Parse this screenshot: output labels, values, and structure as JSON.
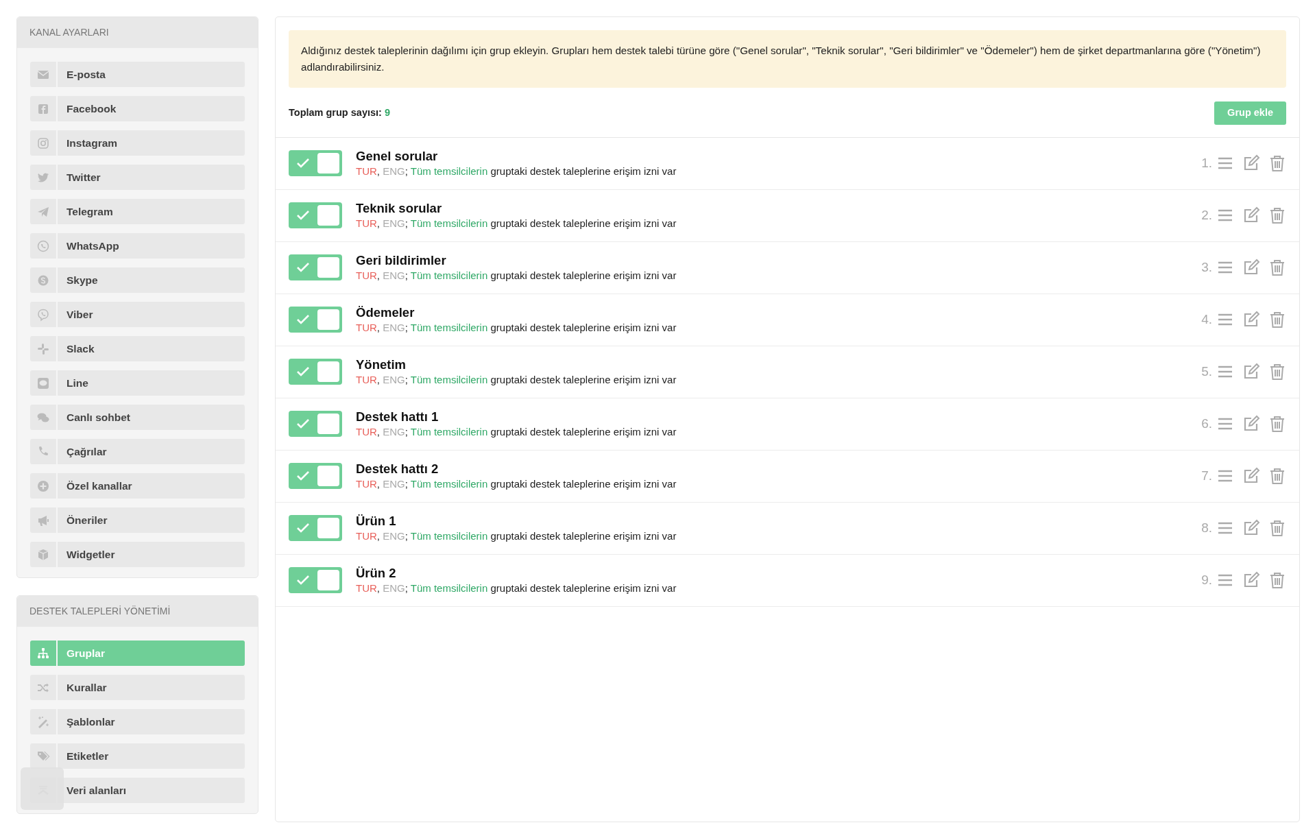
{
  "sidebar": [
    {
      "title": "KANAL AYARLARI",
      "items": [
        {
          "label": "E-posta",
          "selected": false
        },
        {
          "label": "Facebook",
          "selected": false
        },
        {
          "label": "Instagram",
          "selected": false
        },
        {
          "label": "Twitter",
          "selected": false
        },
        {
          "label": "Telegram",
          "selected": false
        },
        {
          "label": "WhatsApp",
          "selected": false
        },
        {
          "label": "Skype",
          "selected": false
        },
        {
          "label": "Viber",
          "selected": false
        },
        {
          "label": "Slack",
          "selected": false
        },
        {
          "label": "Line",
          "selected": false
        },
        {
          "label": "Canlı sohbet",
          "selected": false
        },
        {
          "label": "Çağrılar",
          "selected": false
        },
        {
          "label": "Özel kanallar",
          "selected": false
        },
        {
          "label": "Öneriler",
          "selected": false
        },
        {
          "label": "Widgetler",
          "selected": false
        }
      ]
    },
    {
      "title": "DESTEK TALEPLERİ YÖNETİMİ",
      "items": [
        {
          "label": "Gruplar",
          "selected": true
        },
        {
          "label": "Kurallar",
          "selected": false
        },
        {
          "label": "Şablonlar",
          "selected": false
        },
        {
          "label": "Etiketler",
          "selected": false
        },
        {
          "label": "Veri alanları",
          "selected": false
        }
      ]
    }
  ],
  "info": "Aldığınız destek taleplerinin dağılımı için grup ekleyin. Grupları hem destek talebi türüne göre (\"Genel sorular\", \"Teknik sorular\", \"Geri bildirimler\" ve \"Ödemeler\") hem de şirket departmanlarına göre (\"Yönetim\") adlandırabilirsiniz.",
  "total": {
    "label": "Toplam grup sayısı:",
    "value": "9"
  },
  "add_button": "Grup ekle",
  "groups": [
    {
      "number": "1.",
      "name": "Genel sorular",
      "on": true,
      "description": [
        {
          "text": "TUR",
          "color": "#e8605a"
        },
        {
          "text": ", "
        },
        {
          "text": "ENG",
          "color": "#aaaaaa"
        },
        {
          "text": "; "
        },
        {
          "text": "Tüm temsilcilerin",
          "color": "#2fa866"
        },
        {
          "text": " gruptaki destek taleplerine erişim izni var"
        }
      ]
    },
    {
      "number": "2.",
      "name": "Teknik sorular",
      "on": true,
      "description": [
        {
          "text": "TUR",
          "color": "#e8605a"
        },
        {
          "text": ", "
        },
        {
          "text": "ENG",
          "color": "#aaaaaa"
        },
        {
          "text": "; "
        },
        {
          "text": "Tüm temsilcilerin",
          "color": "#2fa866"
        },
        {
          "text": " gruptaki destek taleplerine erişim izni var"
        }
      ]
    },
    {
      "number": "3.",
      "name": "Geri bildirimler",
      "on": true,
      "description": [
        {
          "text": "TUR",
          "color": "#e8605a"
        },
        {
          "text": ", "
        },
        {
          "text": "ENG",
          "color": "#aaaaaa"
        },
        {
          "text": "; "
        },
        {
          "text": "Tüm temsilcilerin",
          "color": "#2fa866"
        },
        {
          "text": " gruptaki destek taleplerine erişim izni var"
        }
      ]
    },
    {
      "number": "4.",
      "name": "Ödemeler",
      "on": true,
      "description": [
        {
          "text": "TUR",
          "color": "#e8605a"
        },
        {
          "text": ", "
        },
        {
          "text": "ENG",
          "color": "#aaaaaa"
        },
        {
          "text": "; "
        },
        {
          "text": "Tüm temsilcilerin",
          "color": "#2fa866"
        },
        {
          "text": " gruptaki destek taleplerine erişim izni var"
        }
      ]
    },
    {
      "number": "5.",
      "name": "Yönetim",
      "on": true,
      "description": [
        {
          "text": "TUR",
          "color": "#e8605a"
        },
        {
          "text": ", "
        },
        {
          "text": "ENG",
          "color": "#aaaaaa"
        },
        {
          "text": "; "
        },
        {
          "text": "Tüm temsilcilerin",
          "color": "#2fa866"
        },
        {
          "text": " gruptaki destek taleplerine erişim izni var"
        }
      ]
    },
    {
      "number": "6.",
      "name": "Destek hattı 1",
      "on": true,
      "description": [
        {
          "text": "TUR",
          "color": "#e8605a"
        },
        {
          "text": ", "
        },
        {
          "text": "ENG",
          "color": "#aaaaaa"
        },
        {
          "text": "; "
        },
        {
          "text": "Tüm temsilcilerin",
          "color": "#2fa866"
        },
        {
          "text": " gruptaki destek taleplerine erişim izni var"
        }
      ]
    },
    {
      "number": "7.",
      "name": "Destek hattı 2",
      "on": true,
      "description": [
        {
          "text": "TUR",
          "color": "#e8605a"
        },
        {
          "text": ", "
        },
        {
          "text": "ENG",
          "color": "#aaaaaa"
        },
        {
          "text": "; "
        },
        {
          "text": "Tüm temsilcilerin",
          "color": "#2fa866"
        },
        {
          "text": " gruptaki destek taleplerine erişim izni var"
        }
      ]
    },
    {
      "number": "8.",
      "name": "Ürün 1",
      "on": true,
      "description": [
        {
          "text": "TUR",
          "color": "#e8605a"
        },
        {
          "text": ", "
        },
        {
          "text": "ENG",
          "color": "#aaaaaa"
        },
        {
          "text": "; "
        },
        {
          "text": "Tüm temsilcilerin",
          "color": "#2fa866"
        },
        {
          "text": " gruptaki destek taleplerine erişim izni var"
        }
      ]
    },
    {
      "number": "9.",
      "name": "Ürün 2",
      "on": true,
      "description": [
        {
          "text": "TUR",
          "color": "#e8605a"
        },
        {
          "text": ", "
        },
        {
          "text": "ENG",
          "color": "#aaaaaa"
        },
        {
          "text": "; "
        },
        {
          "text": "Tüm temsilcilerin",
          "color": "#2fa866"
        },
        {
          "text": " gruptaki destek taleplerine erişim izni var"
        }
      ]
    }
  ]
}
